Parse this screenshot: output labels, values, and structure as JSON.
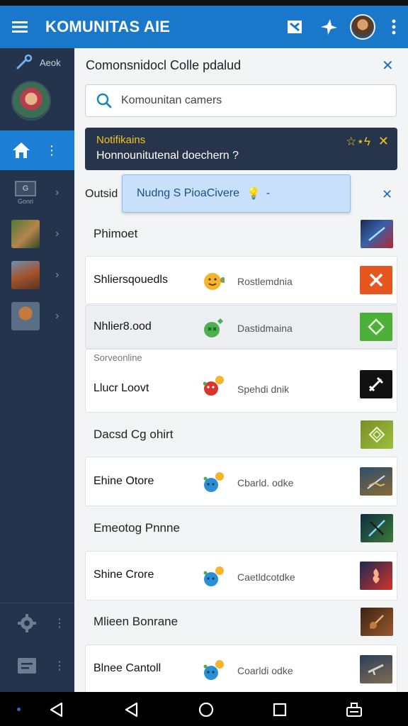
{
  "app": {
    "title": "KOMUNITAS AIE"
  },
  "sidebar": {
    "header_label": "Aeok",
    "games": [
      {
        "label": "Gonri",
        "kind": "box",
        "box_text": "G"
      },
      {
        "label": "",
        "kind": "thumb",
        "colors": [
          "#4f7a3a",
          "#b4844c"
        ]
      },
      {
        "label": "",
        "kind": "thumb",
        "colors": [
          "#a4542d",
          "#6b8fb0"
        ]
      },
      {
        "label": "",
        "kind": "thumb",
        "colors": [
          "#5a6e86",
          "#c47a3c"
        ]
      }
    ]
  },
  "panel": {
    "title": "Comonsnidocl Colle pdalud",
    "search_placeholder": "Komounitan camers"
  },
  "notification": {
    "title": "Notifikains",
    "body": "Honnounitutenal doechern ?",
    "icons": "☆⋆ϟ"
  },
  "outside_label": "Outsid",
  "tooltip": {
    "text": "Nudng S PioaCivere",
    "icon": "💡",
    "suffix": "-"
  },
  "sections": [
    {
      "name": "Phimoet",
      "tile": "tile-rings",
      "tile_colors": [
        "#1b2a4a",
        "#b3262f"
      ]
    },
    {
      "name": "Dacsd Cg ohirt",
      "tile": "tile-diamond",
      "tile_colors": [
        "#7a8f26",
        "#9bbf3a"
      ]
    },
    {
      "name": "Emeotog Pnnne",
      "tile": "tile-slash",
      "tile_colors": [
        "#0e2c46",
        "#3b7a35"
      ]
    },
    {
      "name": "Mlieen Bonrane",
      "tile": "tile-guitar",
      "tile_colors": [
        "#3b2214",
        "#9a5a2c"
      ]
    }
  ],
  "cards": [
    {
      "name": "Shliersqouedls",
      "status": "Rostlemdnia",
      "emo": "smile",
      "tile": "cross",
      "tile_colors": [
        "#e6561f",
        "#f2703a"
      ],
      "subtitle": ""
    },
    {
      "name": "Nhlier8.ood",
      "status": "Dastidmaina",
      "emo": "green",
      "tile": "diamond",
      "tile_colors": [
        "#4caf38",
        "#6fd04f"
      ],
      "subtitle": ""
    },
    {
      "name": "Llucr Loovt",
      "status": "Spehdi dnik",
      "emo": "red",
      "tile": "sword",
      "tile_colors": [
        "#111111",
        "#222222"
      ],
      "subtitle": "Sorveonline"
    },
    {
      "name": "Ehine Otore",
      "status": "Cbarld. odke",
      "emo": "blue",
      "tile": "field",
      "tile_colors": [
        "#2c4e6e",
        "#8a6a34"
      ],
      "subtitle": ""
    },
    {
      "name": "Shine Crore",
      "status": "Caetldcotdke",
      "emo": "blue",
      "tile": "fire",
      "tile_colors": [
        "#1a2a52",
        "#d2342a"
      ],
      "subtitle": ""
    },
    {
      "name": "Blnee Cantoll",
      "status": "Coarldi odke",
      "emo": "blue",
      "tile": "gun",
      "tile_colors": [
        "#2a3f5a",
        "#7f6c52"
      ],
      "subtitle": ""
    }
  ],
  "colors": {
    "accent": "#1978c9",
    "sidebar": "#24344c",
    "notif_bg": "#26354c",
    "notif_title": "#f2c418"
  }
}
